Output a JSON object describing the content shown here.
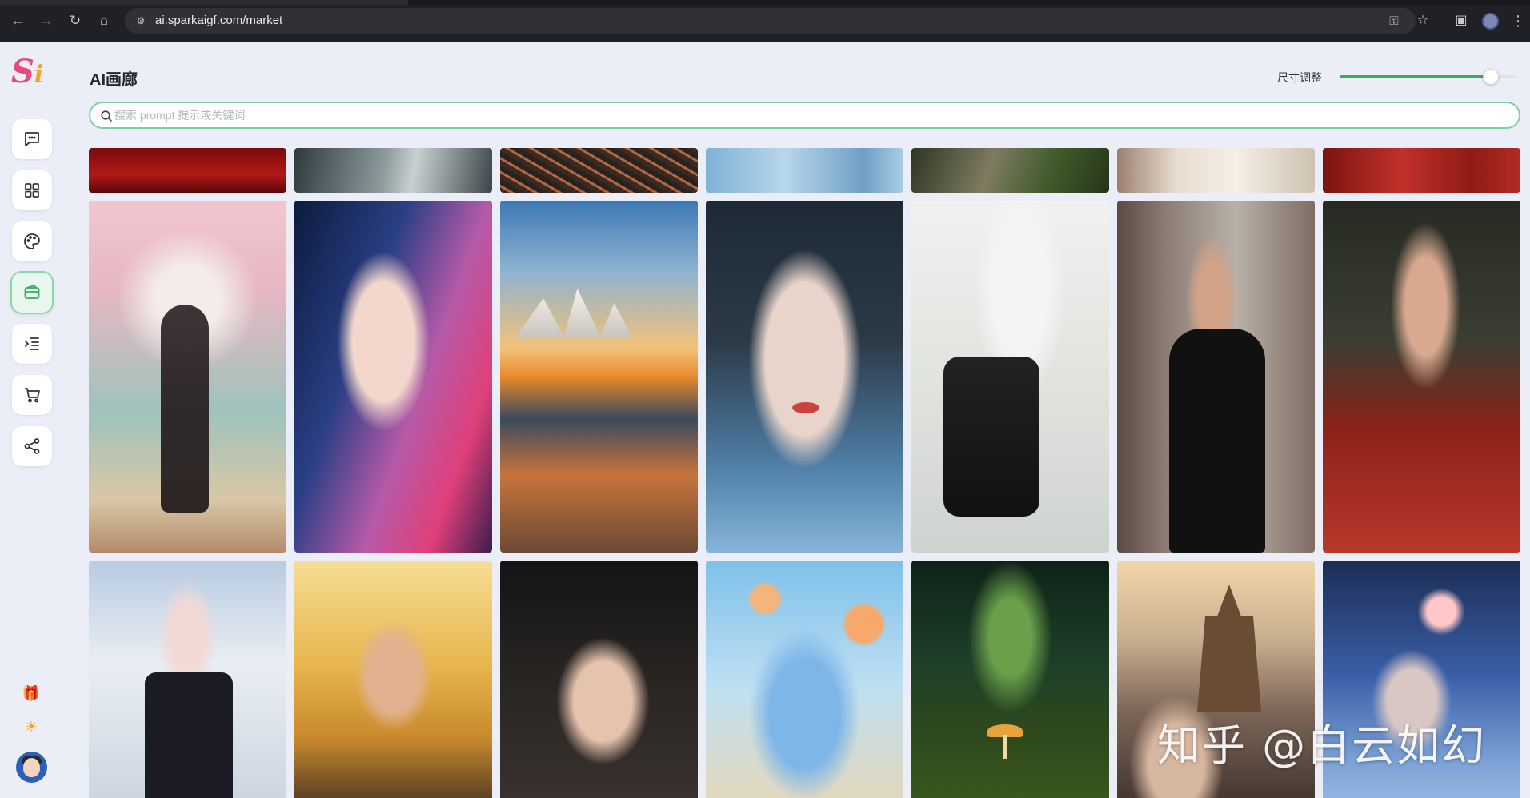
{
  "browser": {
    "url": "ai.sparkaigf.com/market"
  },
  "logo": {
    "s": "S",
    "i": "i"
  },
  "header": {
    "title": "AI画廊",
    "size_label": "尺寸调整",
    "size_value": 0.85
  },
  "search": {
    "placeholder": "搜索 prompt 提示或关键词",
    "value": ""
  },
  "sidebar": {
    "items": [
      {
        "name": "chat",
        "icon": "chat-bubble-icon",
        "active": false
      },
      {
        "name": "apps",
        "icon": "grid-icon",
        "active": false
      },
      {
        "name": "draw",
        "icon": "palette-icon",
        "active": false
      },
      {
        "name": "gallery",
        "icon": "wallet-icon",
        "active": true
      },
      {
        "name": "list",
        "icon": "list-indent-icon",
        "active": false
      },
      {
        "name": "shop",
        "icon": "cart-icon",
        "active": false
      },
      {
        "name": "share",
        "icon": "share-icon",
        "active": false
      }
    ],
    "bottom": [
      {
        "icon": "gift-icon",
        "glyph": "🎁"
      },
      {
        "icon": "sun-icon",
        "glyph": "☀"
      }
    ]
  },
  "gallery": {
    "rows": [
      [
        "cropped-red-fabric",
        "cropped-dark-figure",
        "cropped-pine-needles",
        "cropped-blue-water",
        "cropped-rocks-moss",
        "cropped-lace-dress",
        "cropped-red-robe"
      ],
      [
        "anime-white-hair-warrior",
        "portrait-pink-blue-hair",
        "sydney-opera-house-sunset",
        "portrait-wet-hair",
        "anime-cat-girl-maid",
        "woman-black-dress-street",
        "woman-red-hanfu"
      ],
      [
        "anime-maid-silver-hair",
        "woman-glasses-autumn",
        "portrait-dark-hair",
        "anime-blue-hair-balloons",
        "mushrooms-forest",
        "castle-woman-fantasy",
        "woman-flower-hairpiece"
      ]
    ]
  },
  "watermark": "知乎 @白云如幻"
}
